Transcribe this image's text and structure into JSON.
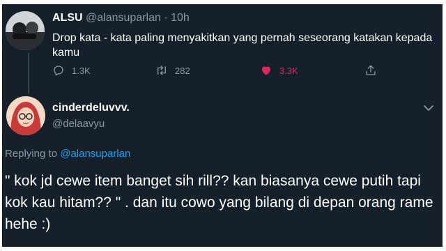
{
  "tweet": {
    "author_name": "ALSU",
    "author_handle": "@alansuparlan",
    "separator": "·",
    "time": "10h",
    "text": "Drop kata - kata paling menyakitkan yang pernah seseorang katakan kepada kamu",
    "reply_count": "1.3K",
    "retweet_count": "282",
    "like_count": "3.3K",
    "liked": true
  },
  "reply": {
    "author_name": "cinderdeluvvv.",
    "author_handle": "@delaavyu",
    "replying_prefix": "Replying to",
    "replying_to": "@alansuparlan",
    "text": "\" kok jd cewe item banget sih rill?? kan biasanya cewe putih tapi kok kau hitam?? \" . dan itu cowo yang bilang di depan orang rame hehe :)"
  },
  "colors": {
    "background": "#15202b",
    "text": "#ffffff",
    "secondary_text": "#8899a6",
    "link": "#1da1f2",
    "like": "#e0245e"
  },
  "icons": [
    "reply-icon",
    "retweet-icon",
    "heart-icon",
    "share-icon",
    "chevron-down-icon"
  ]
}
